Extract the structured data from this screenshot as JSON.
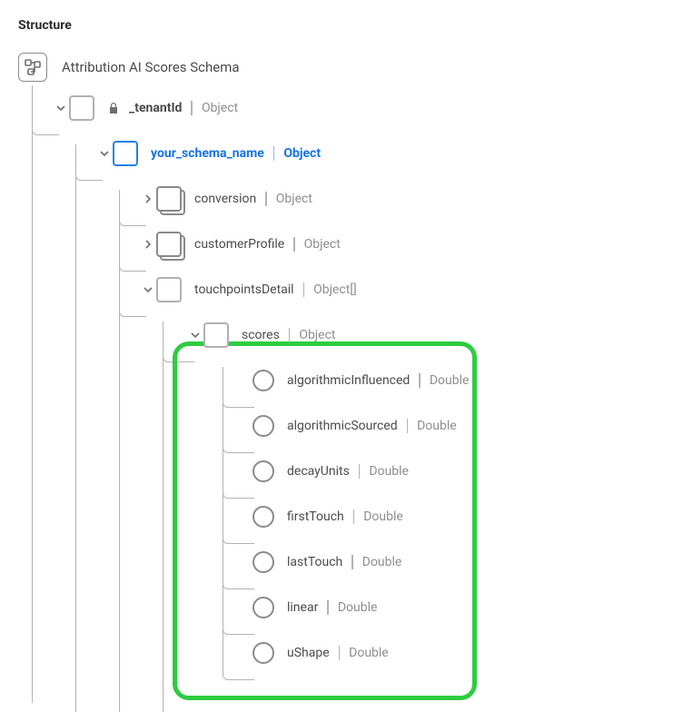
{
  "header": "Structure",
  "root": {
    "title": "Attribution AI Scores Schema"
  },
  "tenant": {
    "name": "_tenantId",
    "type": "Object"
  },
  "schema": {
    "name": "your_schema_name",
    "type": "Object"
  },
  "children": {
    "conversion": {
      "name": "conversion",
      "type": "Object"
    },
    "customerProfile": {
      "name": "customerProfile",
      "type": "Object"
    },
    "touchpointsDetail": {
      "name": "touchpointsDetail",
      "type": "Object[]"
    }
  },
  "scores": {
    "name": "scores",
    "type": "Object",
    "items": [
      {
        "name": "algorithmicInfluenced",
        "type": "Double"
      },
      {
        "name": "algorithmicSourced",
        "type": "Double"
      },
      {
        "name": "decayUnits",
        "type": "Double"
      },
      {
        "name": "firstTouch",
        "type": "Double"
      },
      {
        "name": "lastTouch",
        "type": "Double"
      },
      {
        "name": "linear",
        "type": "Double"
      },
      {
        "name": "uShape",
        "type": "Double"
      }
    ]
  }
}
